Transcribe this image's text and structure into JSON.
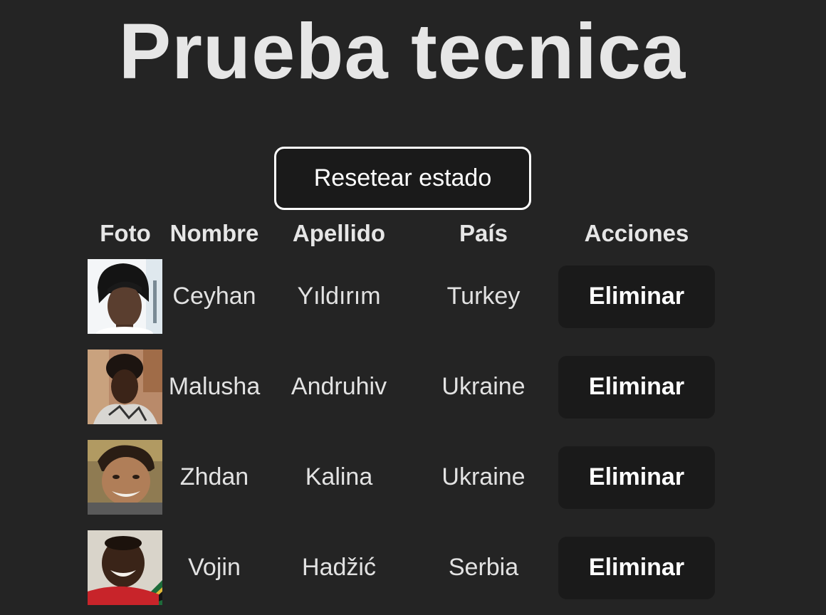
{
  "page": {
    "title": "Prueba tecnica",
    "reset_label": "Resetear estado"
  },
  "table": {
    "headers": {
      "foto": "Foto",
      "nombre": "Nombre",
      "apellido": "Apellido",
      "pais": "País",
      "acciones": "Acciones"
    },
    "rows": [
      {
        "nombre": "Ceyhan",
        "apellido": "Yıldırım",
        "pais": "Turkey",
        "accion": "Eliminar",
        "photo": "avatar-photo"
      },
      {
        "nombre": "Malusha",
        "apellido": "Andruhiv",
        "pais": "Ukraine",
        "accion": "Eliminar",
        "photo": "avatar-photo"
      },
      {
        "nombre": "Zhdan",
        "apellido": "Kalina",
        "pais": "Ukraine",
        "accion": "Eliminar",
        "photo": "avatar-photo"
      },
      {
        "nombre": "Vojin",
        "apellido": "Hadžić",
        "pais": "Serbia",
        "accion": "Eliminar",
        "photo": "avatar-photo"
      }
    ]
  },
  "colors": {
    "background": "#242424",
    "button_bg": "#1a1a1a",
    "text": "#e6e6e6"
  }
}
